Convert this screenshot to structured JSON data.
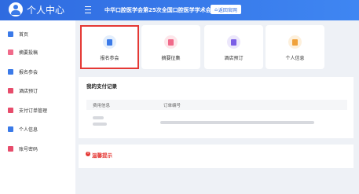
{
  "header": {
    "brand_title": "个人中心",
    "conference_title": "中华口腔医学会第25次全国口腔医学学术会议",
    "back_button": "返回官网",
    "colors": {
      "bar_start": "#2f6be0",
      "bar_end": "#3f86f2"
    }
  },
  "sidebar": {
    "items": [
      {
        "label": "首页",
        "icon": "home-icon",
        "color": "#3b7ae8"
      },
      {
        "label": "摘要投稿",
        "icon": "paper-icon",
        "color": "#f06a8a"
      },
      {
        "label": "报名参会",
        "icon": "register-icon",
        "color": "#3b7ae8"
      },
      {
        "label": "酒店预订",
        "icon": "hotel-icon",
        "color": "#e74c6b"
      },
      {
        "label": "支付订单管理",
        "icon": "order-icon",
        "color": "#e74c6b"
      },
      {
        "label": "个人信息",
        "icon": "user-icon",
        "color": "#3b7ae8"
      },
      {
        "label": "账号密码",
        "icon": "lock-icon",
        "color": "#e74c6b"
      }
    ]
  },
  "cards": [
    {
      "label": "报名参会",
      "icon": "register-icon",
      "bg": "#e3eefc",
      "fg": "#3b7ae8",
      "active": true
    },
    {
      "label": "摘要征集",
      "icon": "paper-icon",
      "bg": "#fde6ea",
      "fg": "#f06a8a",
      "active": false
    },
    {
      "label": "酒店预订",
      "icon": "hotel-icon",
      "bg": "#ece7fb",
      "fg": "#7b5ee6",
      "active": false
    },
    {
      "label": "个人信息",
      "icon": "user-icon",
      "bg": "#fdf0dc",
      "fg": "#f0a23b",
      "active": false
    }
  ],
  "payments": {
    "title": "我的支付记录",
    "columns": [
      "费用信息",
      "订单编号"
    ]
  },
  "notice": {
    "title": "温馨提示",
    "icon": "alert-icon",
    "color": "#e53935"
  }
}
